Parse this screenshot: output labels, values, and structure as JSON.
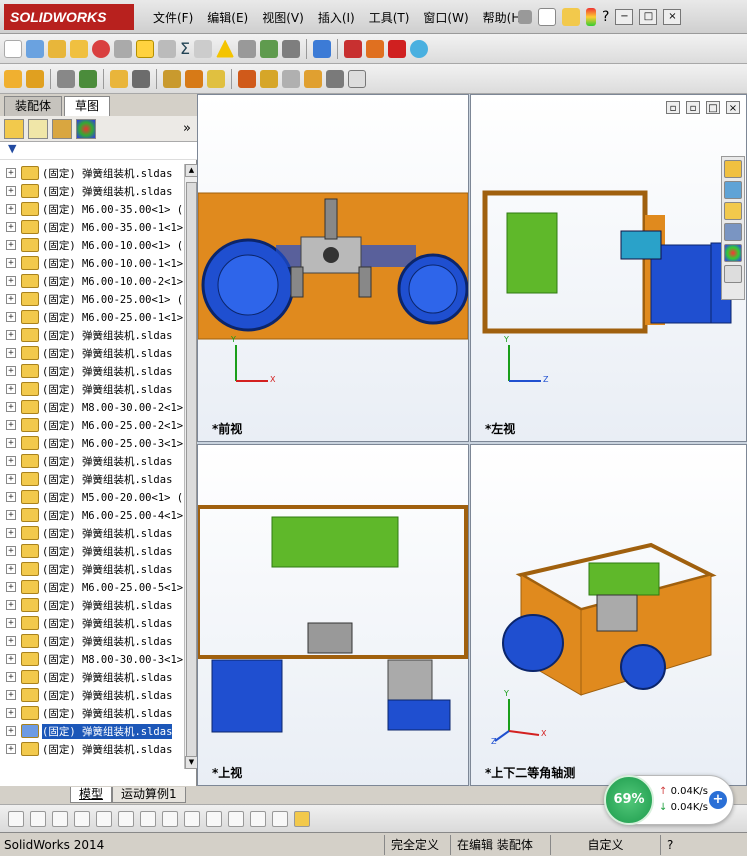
{
  "app": {
    "logo_text": "SOLIDWORKS",
    "menu": [
      "文件(F)",
      "编辑(E)",
      "视图(V)",
      "插入(I)",
      "工具(T)",
      "窗口(W)",
      "帮助(H)"
    ]
  },
  "panel": {
    "tabs": [
      "装配体",
      "草图"
    ],
    "filter_icon": "filter-icon",
    "collapse": "»"
  },
  "tree": {
    "items": [
      "(固定) 弹簧组装机.sldas",
      "(固定) 弹簧组装机.sldas",
      "(固定) M6.00-35.00<1> (",
      "(固定) M6.00-35.00-1<1>",
      "(固定) M6.00-10.00<1> (",
      "(固定) M6.00-10.00-1<1>",
      "(固定) M6.00-10.00-2<1>",
      "(固定) M6.00-25.00<1> (",
      "(固定) M6.00-25.00-1<1>",
      "(固定) 弹簧组装机.sldas",
      "(固定) 弹簧组装机.sldas",
      "(固定) 弹簧组装机.sldas",
      "(固定) 弹簧组装机.sldas",
      "(固定) M8.00-30.00-2<1>",
      "(固定) M6.00-25.00-2<1>",
      "(固定) M6.00-25.00-3<1>",
      "(固定) 弹簧组装机.sldas",
      "(固定) 弹簧组装机.sldas",
      "(固定) M5.00-20.00<1> (",
      "(固定) M6.00-25.00-4<1>",
      "(固定) 弹簧组装机.sldas",
      "(固定) 弹簧组装机.sldas",
      "(固定) 弹簧组装机.sldas",
      "(固定) M6.00-25.00-5<1>",
      "(固定) 弹簧组装机.sldas",
      "(固定) 弹簧组装机.sldas",
      "(固定) 弹簧组装机.sldas",
      "(固定) M8.00-30.00-3<1>",
      "(固定) 弹簧组装机.sldas",
      "(固定) 弹簧组装机.sldas",
      "(固定) 弹簧组装机.sldas",
      "(固定) 弹簧组装机.sldas",
      "(固定) 弹簧组装机.sldas"
    ],
    "selected_index": 31
  },
  "viewports": {
    "front": {
      "label": "*前视",
      "axis_y": "Y",
      "axis_x": "X"
    },
    "left": {
      "label": "*左视",
      "axis_y": "Y",
      "axis_x": "Z"
    },
    "top": {
      "label": "*上视"
    },
    "iso": {
      "label": "*上下二等角轴测",
      "axis_y": "Y",
      "axis_x": "X",
      "axis_z": "Z"
    }
  },
  "bottom_tabs": [
    "模型",
    "运动算例1"
  ],
  "status": {
    "app_version": "SolidWorks 2014",
    "fully_defined": "完全定义",
    "editing": "在编辑 装配体",
    "custom": "自定义",
    "help": "?"
  },
  "net": {
    "percent": "69%",
    "up": "0.04K/s",
    "down": "0.04K/s"
  },
  "colors": {
    "plate": "#e08a1e",
    "motor_blue": "#1f4fd0",
    "box_green": "#5fb82a",
    "select_blue": "#1c57b8"
  }
}
